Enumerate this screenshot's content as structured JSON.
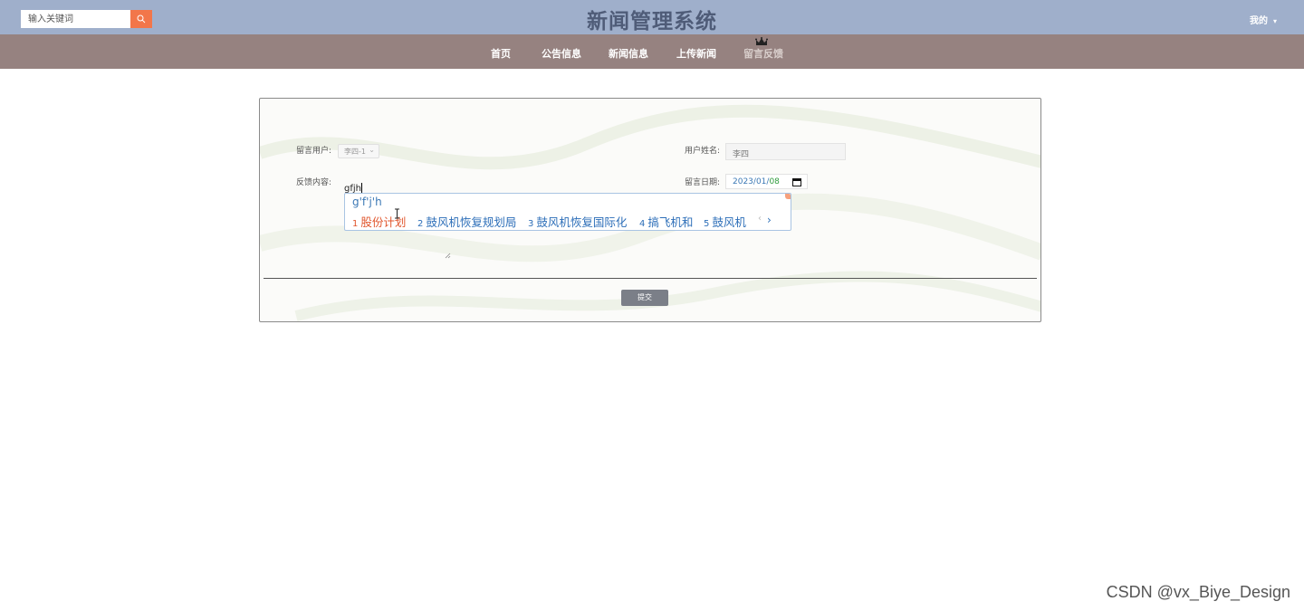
{
  "colors": {
    "topbar_bg": "#9fafcb",
    "navbar_bg": "#968280",
    "search_button": "#f2764a",
    "title_text": "#4f5c78",
    "submit_button": "#7b7f88",
    "ime_highlight": "#e0552c",
    "ime_text": "#2c6eb8"
  },
  "header": {
    "search_placeholder": "输入关键词",
    "search_icon": "search-icon",
    "title": "新闻管理系统",
    "user_menu": "我的"
  },
  "nav": {
    "items": [
      {
        "label": "首页"
      },
      {
        "label": "公告信息"
      },
      {
        "label": "新闻信息"
      },
      {
        "label": "上传新闻"
      },
      {
        "label": "留言反馈"
      }
    ],
    "active_index": 4
  },
  "form": {
    "user_label": "留言用户:",
    "user_value": "李四-1",
    "name_label": "用户姓名:",
    "name_value": "李四",
    "content_label": "反馈内容:",
    "content_value": "gfjh",
    "date_label": "留言日期:",
    "date_year": "2023",
    "date_month": "01",
    "date_day": "08",
    "submit_label": "提交"
  },
  "ime": {
    "pinyin": "g'f'j'h",
    "candidates": [
      {
        "num": "1",
        "text": "股份计划"
      },
      {
        "num": "2",
        "text": "鼓风机恢复规划局"
      },
      {
        "num": "3",
        "text": "鼓风机恢复国际化"
      },
      {
        "num": "4",
        "text": "搞飞机和"
      },
      {
        "num": "5",
        "text": "鼓风机"
      }
    ],
    "next_arrow": "›"
  },
  "watermark": "CSDN @vx_Biye_Design"
}
